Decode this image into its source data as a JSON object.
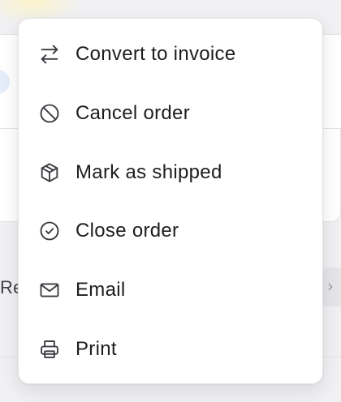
{
  "background": {
    "row_text_fragment": "Re"
  },
  "menu": {
    "items": [
      {
        "label": "Convert to invoice",
        "icon": "arrows-left-right-icon"
      },
      {
        "label": "Cancel order",
        "icon": "ban-icon"
      },
      {
        "label": "Mark as shipped",
        "icon": "package-icon"
      },
      {
        "label": "Close order",
        "icon": "check-circle-icon"
      },
      {
        "label": "Email",
        "icon": "mail-icon"
      },
      {
        "label": "Print",
        "icon": "printer-icon"
      }
    ]
  },
  "colors": {
    "icon_stroke": "#3a3a40",
    "text": "#1d1d20",
    "menu_bg": "#ffffff",
    "page_bg": "#f1f1f3"
  }
}
